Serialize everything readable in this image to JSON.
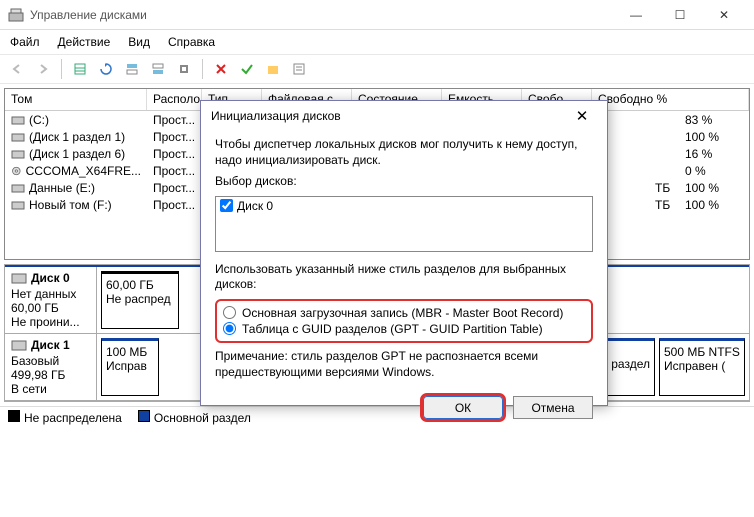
{
  "window": {
    "title": "Управление дисками"
  },
  "menu": {
    "file": "Файл",
    "action": "Действие",
    "view": "Вид",
    "help": "Справка"
  },
  "columns": {
    "tom": "Том",
    "raspo": "Располо...",
    "tip": "Тип",
    "fs": "Файловая с",
    "sost": "Состояние",
    "emk": "Емкость",
    "svob": "Свобо",
    "svobpct": "Свободно %"
  },
  "volumes": [
    {
      "name": "(C:)",
      "lay": "Прост...",
      "pct": "83 %"
    },
    {
      "name": "(Диск 1 раздел 1)",
      "lay": "Прост...",
      "pct": "100 %"
    },
    {
      "name": "(Диск 1 раздел 6)",
      "lay": "Прост...",
      "pct": "16 %"
    },
    {
      "name": "CCCOMA_X64FRE...",
      "lay": "Прост...",
      "pct": "0 %",
      "cd": true
    },
    {
      "name": "Данные (E:)",
      "lay": "Прост...",
      "pct": "100 %",
      "tail": "ТБ"
    },
    {
      "name": "Новый том (F:)",
      "lay": "Прост...",
      "pct": "100 %",
      "tail": "ТБ"
    }
  ],
  "disk0": {
    "title": "Диск 0",
    "l1": "Нет данных",
    "l2": "60,00 ГБ",
    "l3": "Не проини...",
    "b1a": "60,00 ГБ",
    "b1b": "Не распред"
  },
  "disk1": {
    "title": "Диск 1",
    "l1": "Базовый",
    "l2": "499,98 ГБ",
    "l3": "В сети",
    "b1a": "100 МБ",
    "b1b": "Исправ",
    "b2a": "ый раздел",
    "b3a": "500 МБ NTFS",
    "b3b": "Исправен ("
  },
  "legend": {
    "unalloc": "Не распределена",
    "primary": "Основной раздел"
  },
  "dialog": {
    "title": "Инициализация дисков",
    "intro": "Чтобы диспетчер локальных дисков мог получить к нему доступ, надо инициализировать диск.",
    "select_label": "Выбор дисков:",
    "disk_item": "Диск 0",
    "style_label": "Использовать указанный ниже стиль разделов для выбранных дисков:",
    "mbr": "Основная загрузочная запись (MBR - Master Boot Record)",
    "gpt": "Таблица с GUID разделов (GPT - GUID Partition Table)",
    "note": "Примечание: стиль разделов GPT не распознается всеми предшествующими версиями Windows.",
    "ok": "ОК",
    "cancel": "Отмена"
  }
}
